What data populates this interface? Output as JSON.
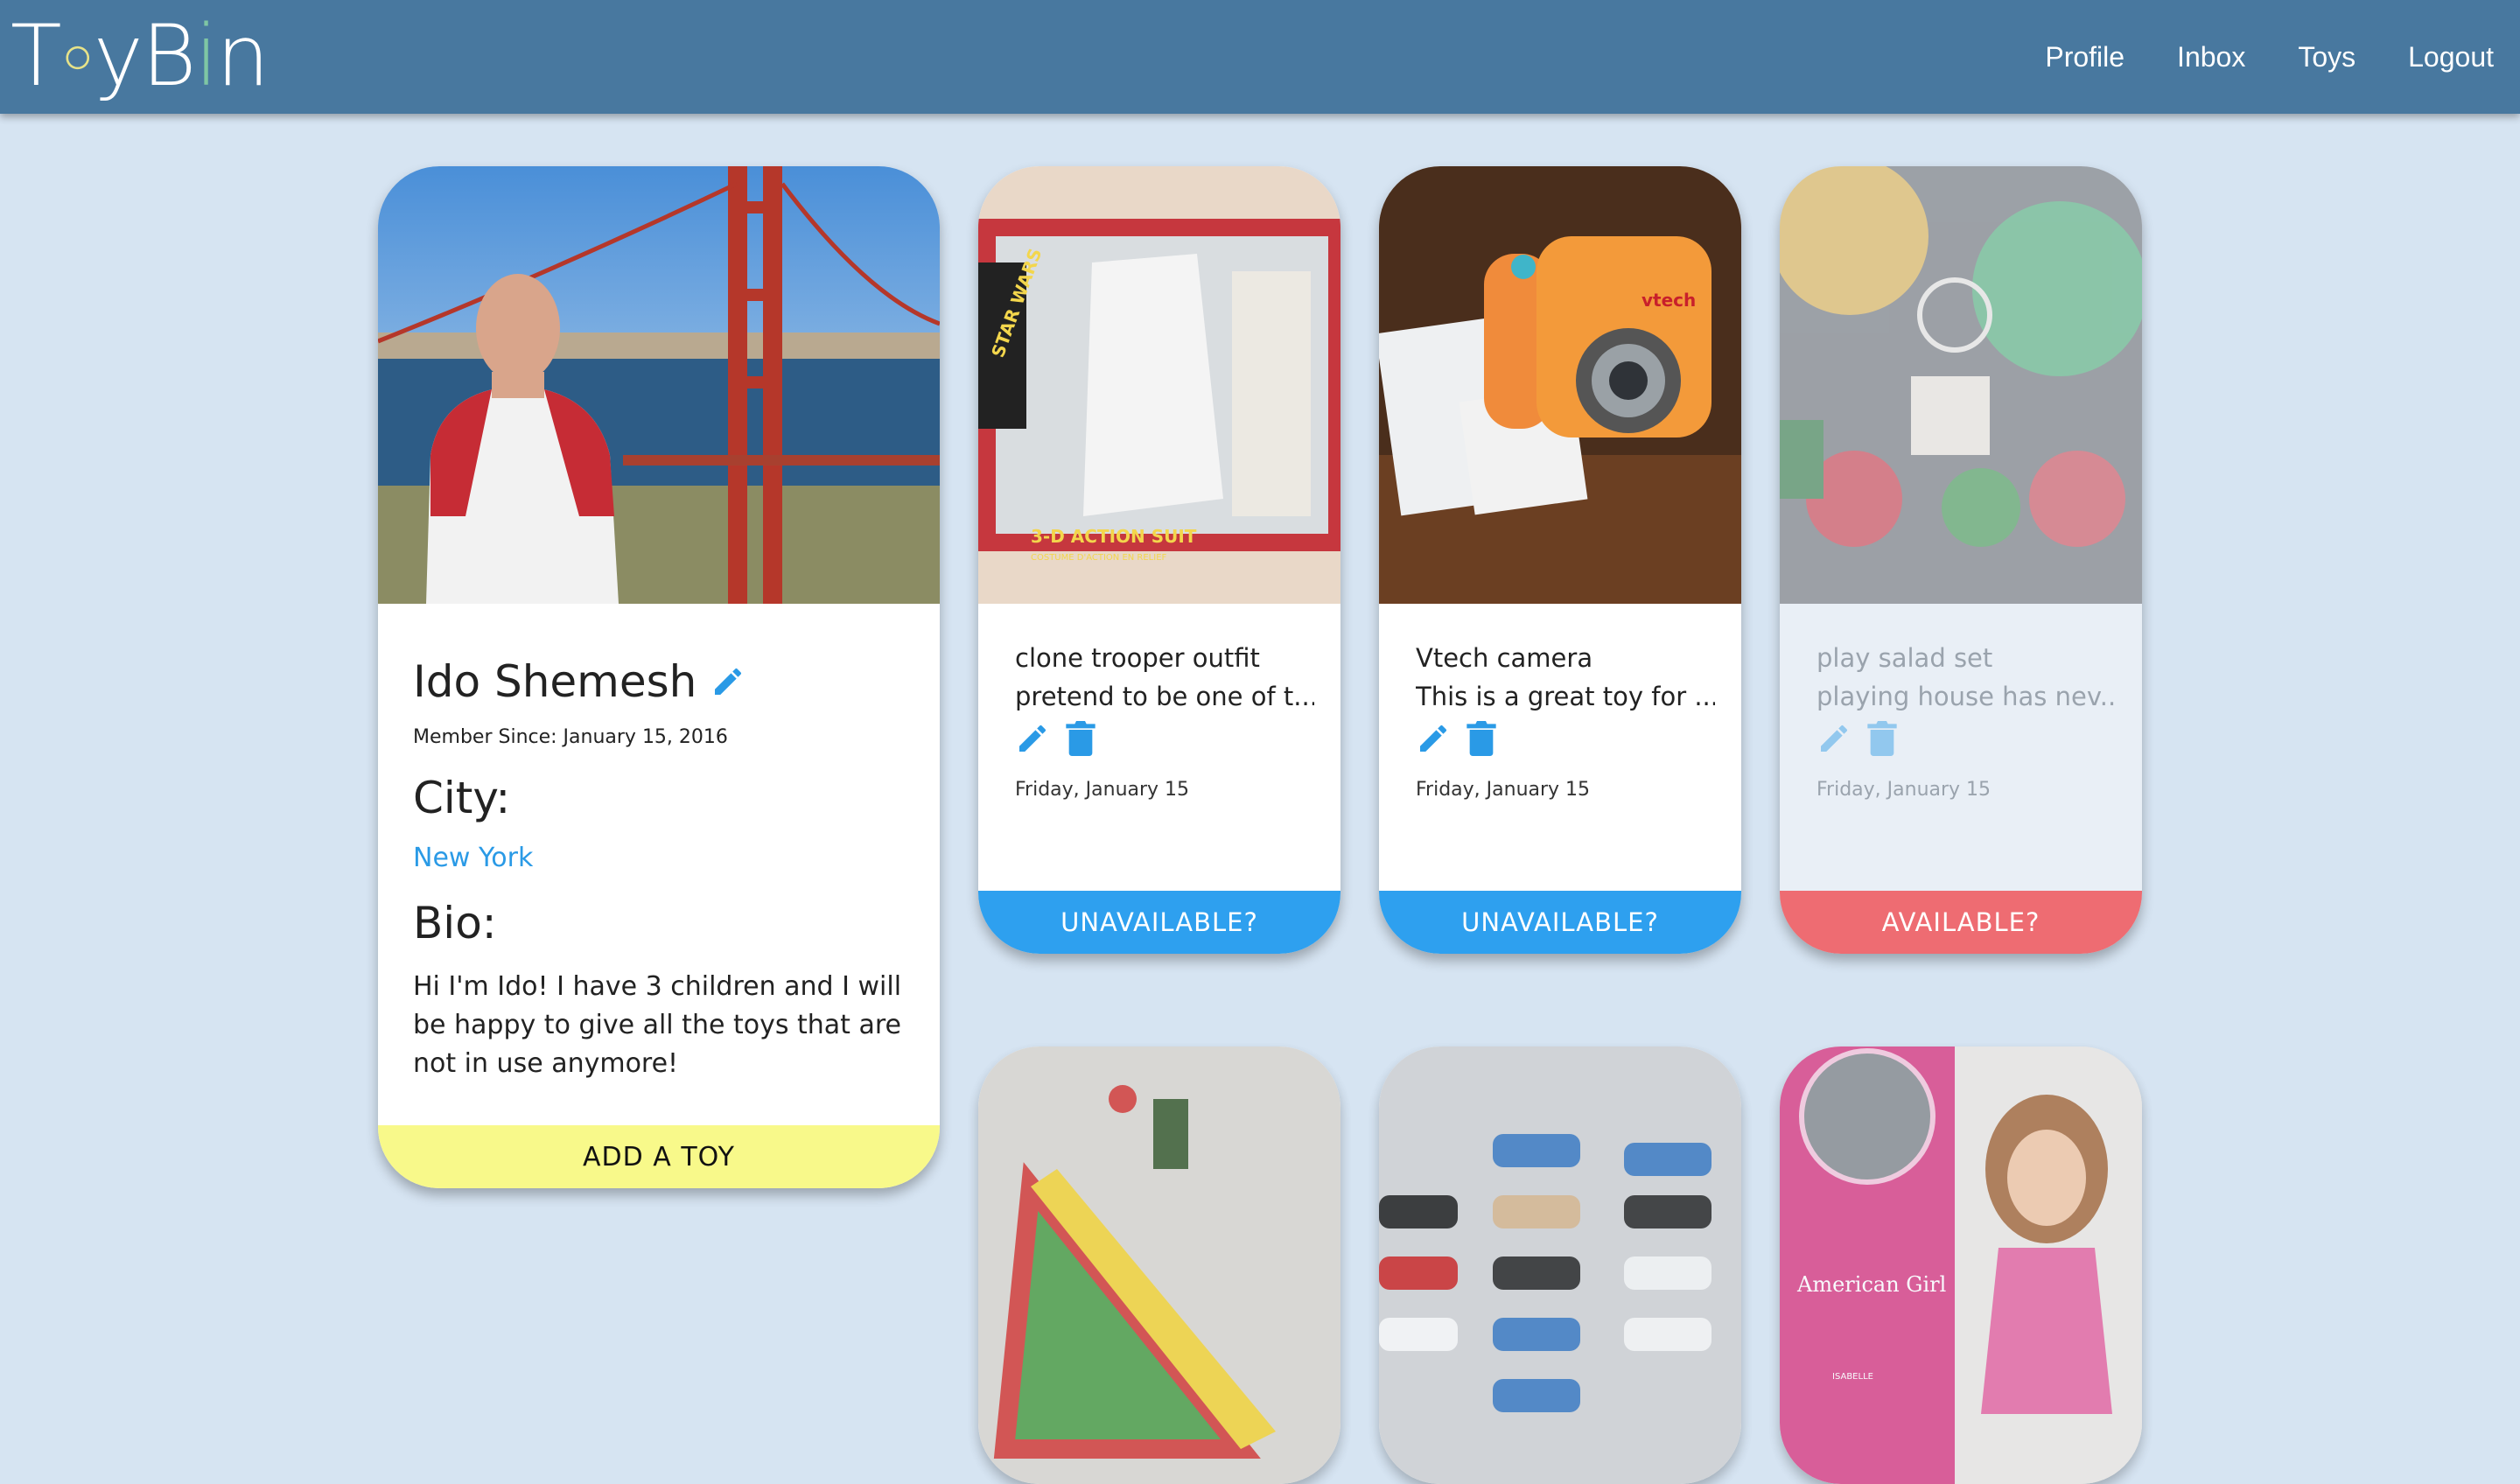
{
  "app": {
    "logo_text": "ToyBin"
  },
  "nav": {
    "profile": "Profile",
    "inbox": "Inbox",
    "toys": "Toys",
    "logout": "Logout"
  },
  "profile": {
    "name": "Ido Shemesh",
    "member_since": "Member Since: January 15, 2016",
    "city_label": "City:",
    "city": "New York",
    "bio_label": "Bio:",
    "bio": "Hi I'm Ido! I have 3 children and I will be happy to give all the toys that are not in use anymore!",
    "add_toy_label": "ADD A TOY"
  },
  "toys": [
    {
      "title": "clone trooper outfit",
      "desc": "pretend to be one of t...",
      "date": "Friday, January 15",
      "button": "UNAVAILABLE?",
      "photo_text_1": "STAR WARS",
      "photo_text_2": "3-D ACTION SUIT",
      "photo_text_3": "COSTUME D'ACTION EN RELIEF"
    },
    {
      "title": "Vtech camera",
      "desc": "This is a great toy for ...",
      "date": "Friday, January 15",
      "button": "UNAVAILABLE?",
      "photo_text_1": "vtech"
    },
    {
      "title": "play salad set",
      "desc": "playing house has nev...",
      "date": "Friday, January 15",
      "button": "AVAILABLE?"
    }
  ],
  "lower_toys": [
    {
      "photo_text_1": "American Girl",
      "photo_text_2": "ISABELLE"
    }
  ],
  "colors": {
    "navbar": "#48789f",
    "background": "#d6e4f2",
    "accent_blue": "#2ea0ef",
    "available_red": "#ee6c72",
    "add_yellow": "#f8f98a"
  }
}
